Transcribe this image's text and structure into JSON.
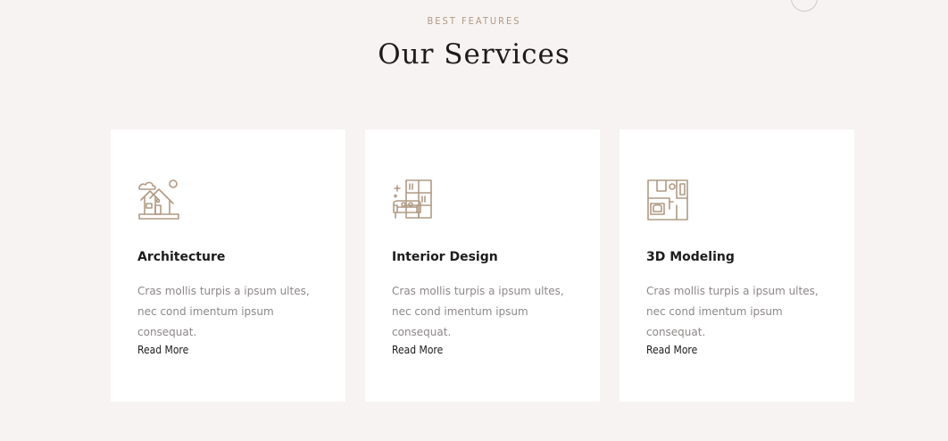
{
  "header": {
    "eyebrow": "BEST FEATURES",
    "title": "Our Services"
  },
  "services": [
    {
      "title": "Architecture",
      "description": "Cras mollis turpis a ipsum ultes, nec cond imentum ipsum consequat.",
      "link_label": "Read More",
      "icon": "house-icon"
    },
    {
      "title": "Interior Design",
      "description": "Cras mollis turpis a ipsum ultes, nec cond imentum ipsum consequat.",
      "link_label": "Read More",
      "icon": "sofa-shelf-icon"
    },
    {
      "title": "3D Modeling",
      "description": "Cras mollis turpis a ipsum ultes, nec cond imentum ipsum consequat.",
      "link_label": "Read More",
      "icon": "floor-plan-icon"
    }
  ],
  "colors": {
    "background": "#f7f3f2",
    "card": "#ffffff",
    "accent": "#b09a83",
    "heading": "#1d1b1b",
    "body_text": "#8d8888"
  }
}
